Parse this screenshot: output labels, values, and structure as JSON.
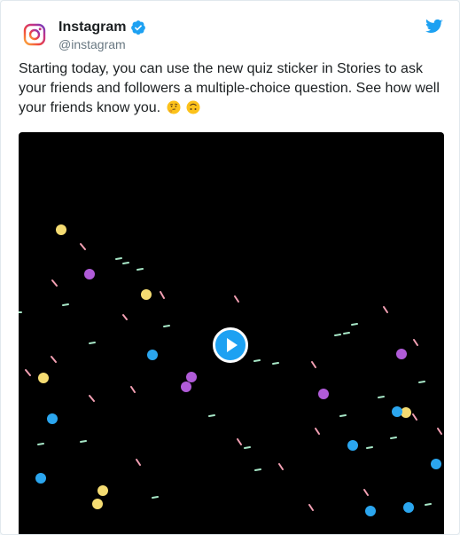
{
  "tweet": {
    "author_name": "Instagram",
    "author_handle": "@instagram",
    "verified": true,
    "text": "Starting today, you can use the new quiz sticker in Stories to ask your friends and followers a multiple-choice question. See how well your friends know you.",
    "emojis": [
      "thinking-face-emoji",
      "upside-down-face-emoji"
    ]
  },
  "icons": {
    "avatar": "instagram-logo",
    "verified": "verified-badge-icon",
    "platform": "twitter-bird-icon",
    "media_control": "play-icon"
  },
  "colors": {
    "brand_blue": "#1da1f2",
    "text": "#1c2022",
    "muted_text": "#697882",
    "media_background": "#000000",
    "confetti_yellow": "#f5dc72",
    "confetti_purple": "#b05bd8",
    "confetti_blue": "#2ba6ef",
    "confetti_pink": "#f3a0b3",
    "confetti_mint": "#a8e8c8"
  }
}
